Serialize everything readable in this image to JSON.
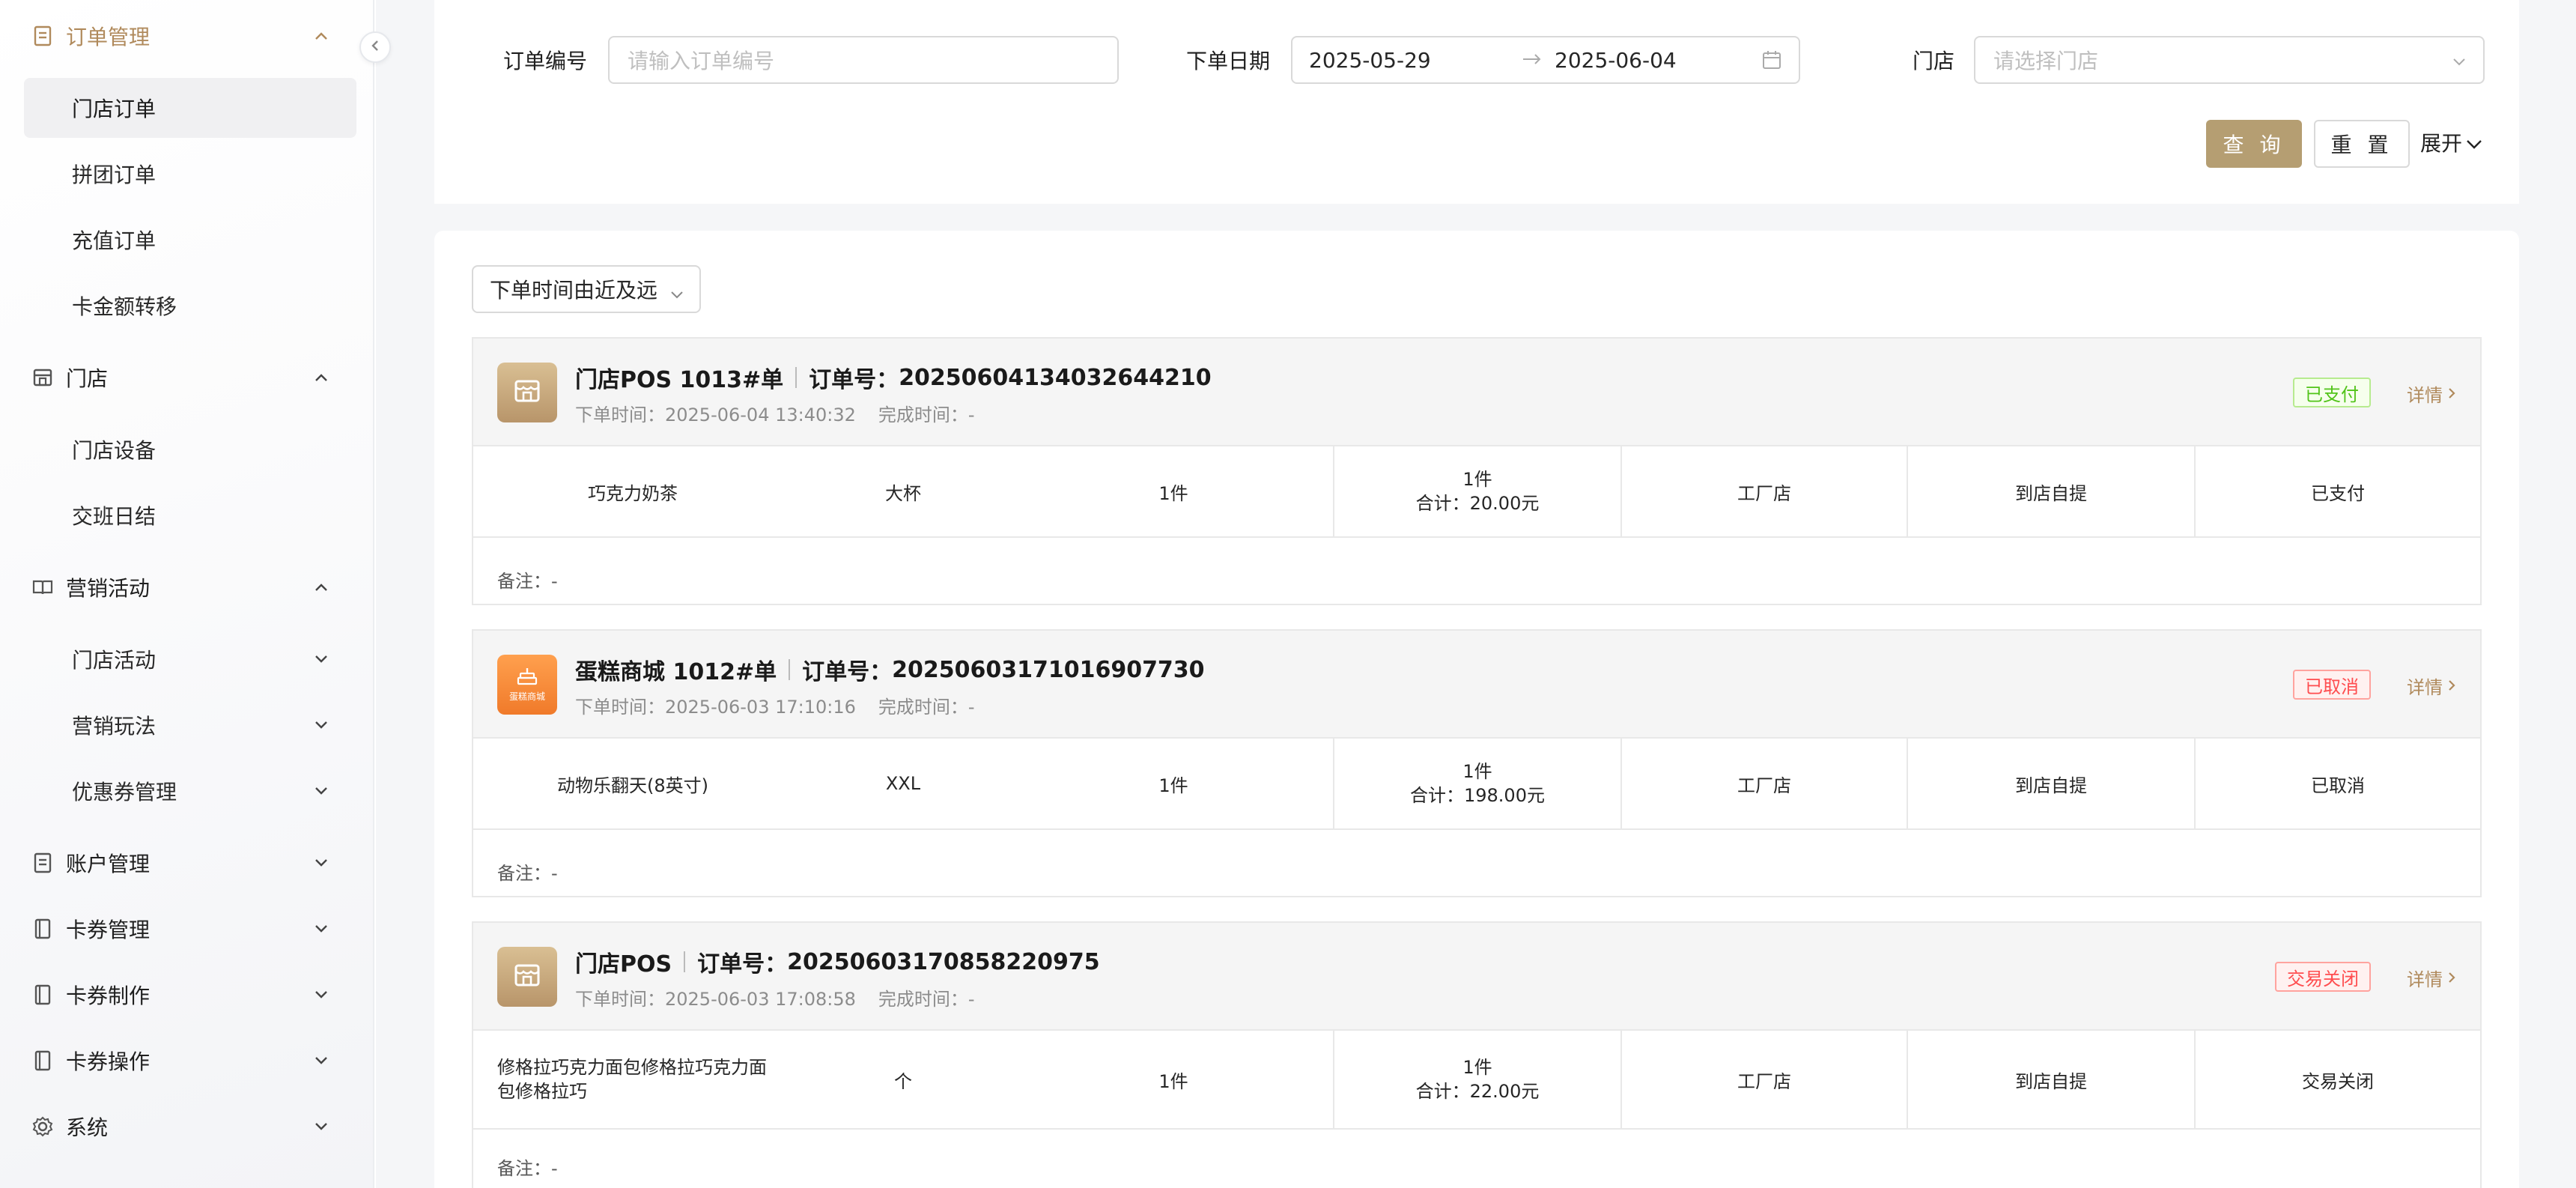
{
  "sidebar": {
    "groups": [
      {
        "label": "订单管理",
        "items": [
          "门店订单",
          "拼团订单",
          "充值订单",
          "卡金额转移"
        ]
      },
      {
        "label": "门店",
        "items": [
          "门店设备",
          "交班日结"
        ]
      },
      {
        "label": "营销活动",
        "items": [
          "门店活动",
          "营销玩法",
          "优惠券管理"
        ]
      },
      {
        "label": "账户管理"
      },
      {
        "label": "卡券管理"
      },
      {
        "label": "卡券制作"
      },
      {
        "label": "卡券操作"
      },
      {
        "label": "系统"
      }
    ]
  },
  "filters": {
    "order_no_label": "订单编号",
    "order_no_placeholder": "请输入订单编号",
    "date_label": "下单日期",
    "date_start": "2025-05-29",
    "date_end": "2025-06-04",
    "store_label": "门店",
    "store_placeholder": "请选择门店",
    "query_label": "查 询",
    "reset_label": "重 置",
    "expand_label": "展开"
  },
  "sort": {
    "selected": "下单时间由近及远"
  },
  "orders": [
    {
      "source": "门店POS 1013#单",
      "order_no_label": "订单号：",
      "order_no": "20250604134032644210",
      "created": "下单时间：2025-06-04 13:40:32",
      "completed": "完成时间：-",
      "status_badge": "已支付",
      "detail": "详情",
      "row": {
        "product": "巧克力奶茶",
        "spec": "大杯",
        "qty": "1件",
        "sum_qty": "1件",
        "sum_total": "合计：20.00元",
        "store": "工厂店",
        "delivery": "到店自提",
        "status": "已支付"
      },
      "remark": "备注：-"
    },
    {
      "source": "蛋糕商城 1012#单",
      "order_no_label": "订单号：",
      "order_no": "20250603171016907730",
      "created": "下单时间：2025-06-03 17:10:16",
      "completed": "完成时间：-",
      "status_badge": "已取消",
      "detail": "详情",
      "logo_text": "蛋糕商城",
      "row": {
        "product": "动物乐翻天(8英寸)",
        "spec": "XXL",
        "qty": "1件",
        "sum_qty": "1件",
        "sum_total": "合计：198.00元",
        "store": "工厂店",
        "delivery": "到店自提",
        "status": "已取消"
      },
      "remark": "备注：-"
    },
    {
      "source": "门店POS",
      "order_no_label": "订单号：",
      "order_no": "20250603170858220975",
      "created": "下单时间：2025-06-03 17:08:58",
      "completed": "完成时间：-",
      "status_badge": "交易关闭",
      "detail": "详情",
      "row": {
        "product_line1": "修格拉巧克力面包修格拉巧克力面",
        "product_line2": "包修格拉巧",
        "spec": "个",
        "qty": "1件",
        "sum_qty": "1件",
        "sum_total": "合计：22.00元",
        "store": "工厂店",
        "delivery": "到店自提",
        "status": "交易关闭"
      },
      "remark": "备注：-"
    }
  ],
  "colors": {
    "accent": "#b59e72",
    "active_menu": "#b08a5c",
    "paid": "#52c41a",
    "cancel": "#ff4d4f"
  }
}
